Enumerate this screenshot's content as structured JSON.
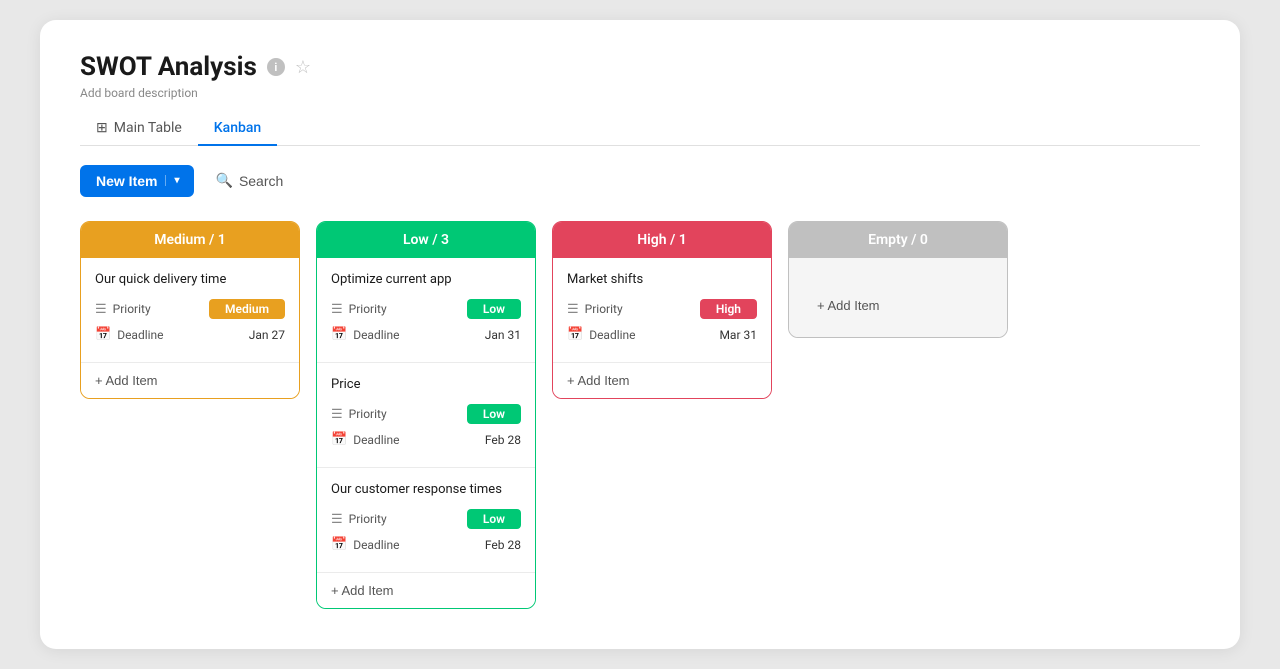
{
  "app": {
    "title": "SWOT Analysis",
    "description": "Add board description"
  },
  "tabs": [
    {
      "id": "main-table",
      "label": "Main Table",
      "icon": "⊞",
      "active": false
    },
    {
      "id": "kanban",
      "label": "Kanban",
      "icon": "",
      "active": true
    }
  ],
  "toolbar": {
    "new_item_label": "New Item",
    "search_label": "Search"
  },
  "columns": [
    {
      "id": "medium",
      "header": "Medium / 1",
      "color_class": "medium",
      "cards": [
        {
          "title": "Our quick delivery time",
          "priority": "Medium",
          "priority_class": "medium",
          "deadline": "Jan 27"
        }
      ],
      "add_item_label": "+ Add Item"
    },
    {
      "id": "low",
      "header": "Low / 3",
      "color_class": "low",
      "cards": [
        {
          "title": "Optimize current app",
          "priority": "Low",
          "priority_class": "low",
          "deadline": "Jan 31"
        },
        {
          "title": "Price",
          "priority": "Low",
          "priority_class": "low",
          "deadline": "Feb 28"
        },
        {
          "title": "Our customer response times",
          "priority": "Low",
          "priority_class": "low",
          "deadline": "Feb 28"
        }
      ],
      "add_item_label": "+ Add Item"
    },
    {
      "id": "high",
      "header": "High / 1",
      "color_class": "high",
      "cards": [
        {
          "title": "Market shifts",
          "priority": "High",
          "priority_class": "high",
          "deadline": "Mar 31"
        }
      ],
      "add_item_label": "+ Add Item"
    },
    {
      "id": "empty",
      "header": "Empty / 0",
      "color_class": "empty",
      "cards": [],
      "add_item_label": "+ Add Item"
    }
  ],
  "labels": {
    "priority": "Priority",
    "deadline": "Deadline"
  }
}
